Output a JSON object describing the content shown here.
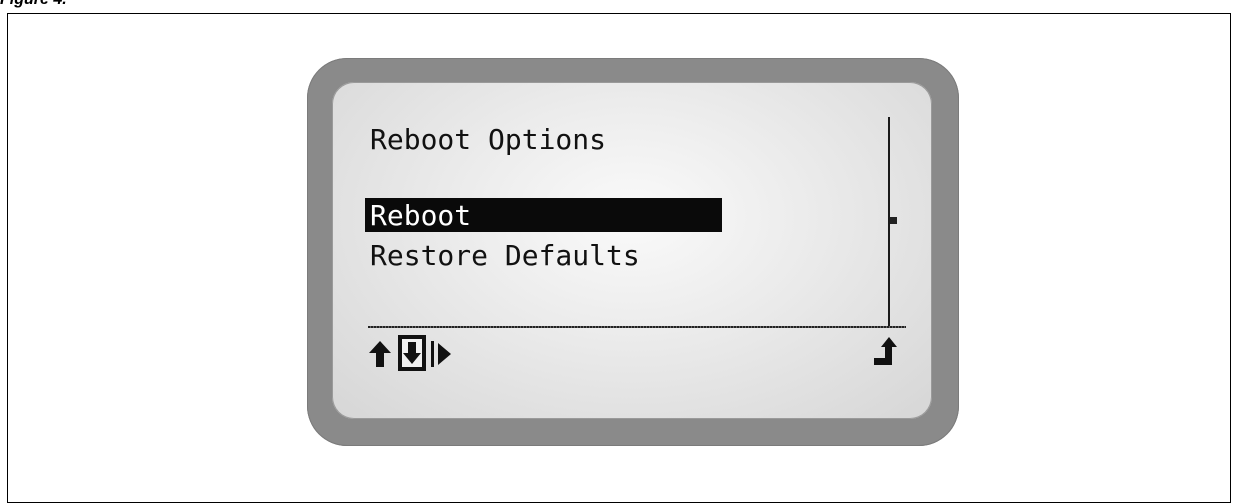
{
  "figure": {
    "caption": "Figure 4."
  },
  "lcd": {
    "title": "Reboot Options",
    "menu_items": [
      {
        "label": "Reboot",
        "selected": true
      },
      {
        "label": "Restore Defaults",
        "selected": false
      }
    ],
    "softkeys": {
      "left_icons": [
        "up-arrow-icon",
        "down-arrow-selected-icon",
        "play-right-icon"
      ],
      "right_icon": "enter-return-icon"
    },
    "colors": {
      "bezel": "#8a8a8a",
      "screen": "#ececec",
      "text": "#111111",
      "highlight": "#0a0a0a"
    }
  }
}
